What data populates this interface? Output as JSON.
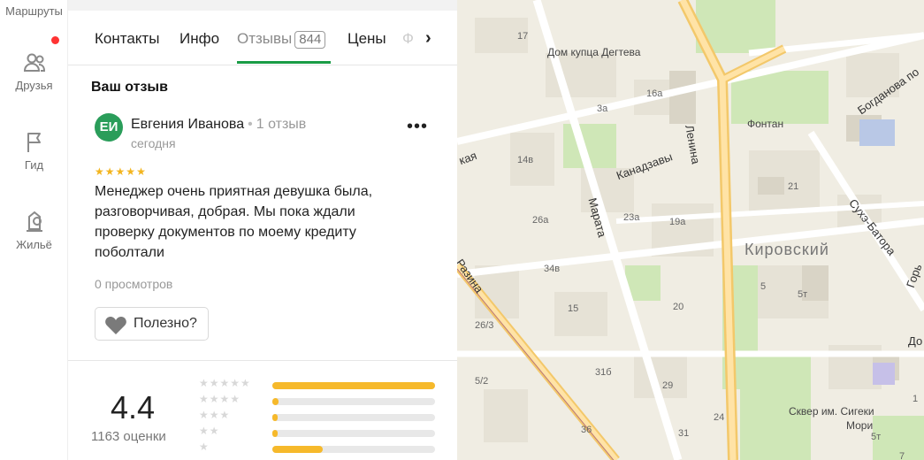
{
  "rail": {
    "routes_label": "Маршруты",
    "friends_label": "Друзья",
    "guide_label": "Гид",
    "housing_label": "Жильё"
  },
  "tabs": {
    "contacts": "Контакты",
    "info": "Инфо",
    "reviews": "Отзывы",
    "reviews_count": "844",
    "prices": "Цены",
    "ghost": "Ф"
  },
  "my_review": {
    "title": "Ваш отзыв",
    "avatar_initials": "ЕИ",
    "author": "Евгения Иванова",
    "author_reviews": "1 отзыв",
    "date": "сегодня",
    "stars_filled": 5,
    "text": "Менеджер очень приятная девушка была, разговорчивая, добрая. Мы пока ждали проверку документов по моему кредиту поболтали",
    "views": "0 просмотров",
    "useful_label": "Полезно?"
  },
  "rating": {
    "value": "4.4",
    "count_label": "1163 оценки",
    "distribution": [
      {
        "stars": 5,
        "fraction": 1.0
      },
      {
        "stars": 4,
        "fraction": 0.04
      },
      {
        "stars": 3,
        "fraction": 0.03
      },
      {
        "stars": 2,
        "fraction": 0.03
      },
      {
        "stars": 1,
        "fraction": 0.31
      }
    ]
  },
  "map": {
    "labels": {
      "dom_kupca": "Дом купца Дегтева",
      "fontan": "Фонтан",
      "district": "Кировский",
      "skver": "Сквер им. Сигеки",
      "skver2": "Мори",
      "lenina": "Ленина",
      "marata": "Марата",
      "kanadzavy": "Канадзавы",
      "bogdanova": "Богданова по",
      "sukhe": "Сухэ-Батора",
      "razina": "Разина",
      "gor": "Горь",
      "do": "До",
      "kaya": "кая"
    },
    "numbers": [
      "17",
      "3а",
      "16а",
      "14в",
      "26а",
      "23а",
      "19а",
      "21",
      "34в",
      "15",
      "20",
      "5",
      "5т",
      "26/3",
      "31б",
      "29",
      "24",
      "36",
      "5/2",
      "31",
      "7",
      "1",
      "5т"
    ]
  }
}
